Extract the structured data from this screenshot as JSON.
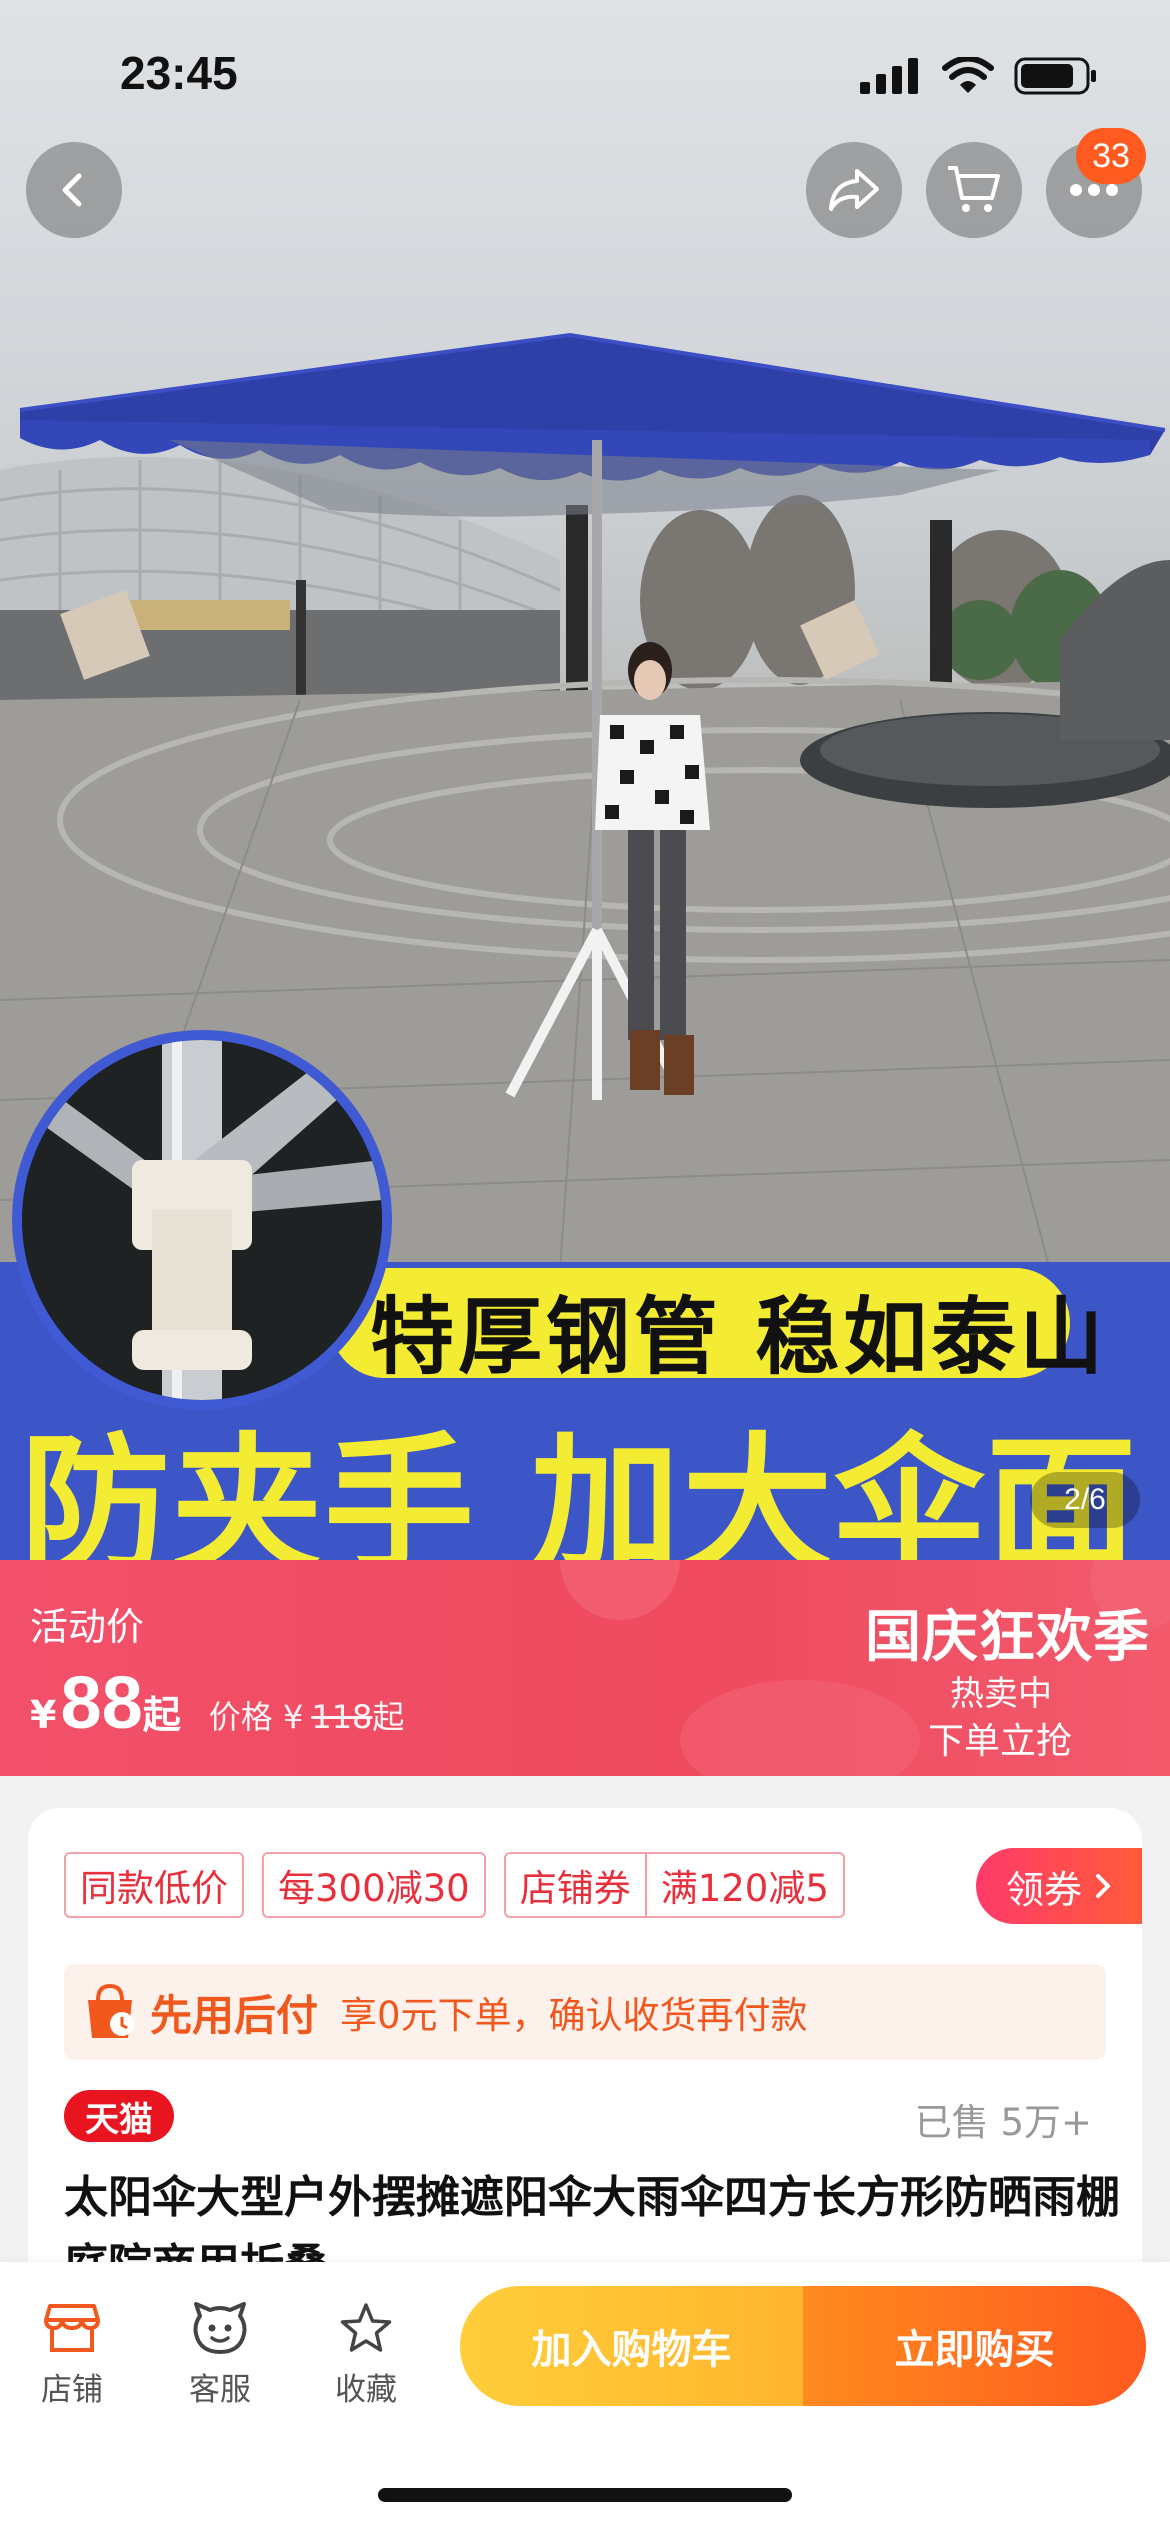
{
  "status_bar": {
    "time": "23:45"
  },
  "top_nav": {
    "badge_count": "33"
  },
  "hero": {
    "banner_line1": "特厚钢管 稳如泰山",
    "banner_line2": "防夹手  加大伞面",
    "image_counter": "2/6"
  },
  "price": {
    "label": "活动价",
    "currency": "¥",
    "amount": "88",
    "suffix": "起",
    "original_label": "价格 ¥",
    "original_amount": "118",
    "original_suffix": "起",
    "promo_title": "国庆狂欢季",
    "promo_sub1": "热卖中",
    "promo_sub2": "下单立抢"
  },
  "coupons": {
    "items": [
      "同款低价",
      "每300减30"
    ],
    "pair": [
      "店铺券",
      "满120减5"
    ],
    "claim_label": "领券"
  },
  "pay_after": {
    "title": "先用后付",
    "desc": "享0元下单，确认收货再付款"
  },
  "product": {
    "tag": "天猫",
    "sold": "已售 5万+",
    "title": "太阳伞大型户外摆摊遮阳伞大雨伞四方长方形防晒雨棚庭院商用折叠"
  },
  "bottom_bar": {
    "store_label": "店铺",
    "service_label": "客服",
    "favorite_label": "收藏",
    "add_cart_label": "加入购物车",
    "buy_now_label": "立即购买"
  },
  "colors": {
    "accent_red": "#e8303c",
    "price_banner": "#ef4a5e",
    "banner_blue": "#3c56c8",
    "banner_yellow": "#f4ec33",
    "cart_button": "#ffbf33",
    "buy_button": "#ff6a1f"
  }
}
